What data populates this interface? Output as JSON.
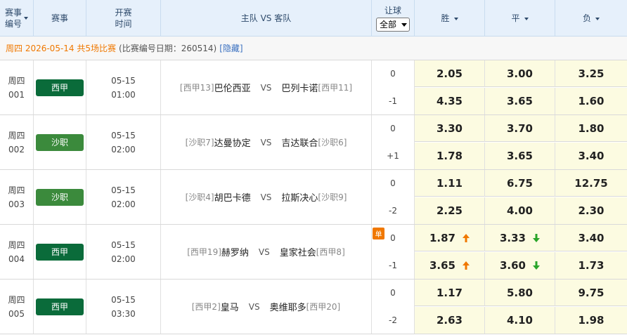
{
  "header": {
    "col_no_line1": "赛事",
    "col_no_line2": "编号",
    "col_league": "赛事",
    "col_time_line1": "开赛",
    "col_time_line2": "时间",
    "col_match": "主队 VS 客队",
    "col_handicap": "让球",
    "handicap_select_value": "全部",
    "col_win": "胜",
    "col_draw": "平",
    "col_lose": "负"
  },
  "dateline": {
    "summary": "周四 2026-05-14 共5场比赛",
    "detail": "(比赛编号日期：260514)",
    "hide_link": "[隐藏]"
  },
  "colors": {
    "la_liga": "#0a6b3a",
    "saudi": "#3b8a3c",
    "odds_bg": "#fcfbe1",
    "up": "#f07800",
    "down": "#2aa52a"
  },
  "matches": [
    {
      "no_day": "周四",
      "no_num": "001",
      "league": "西甲",
      "league_color": "#0a6b3a",
      "date": "05-15",
      "time": "01:00",
      "home_rank": "[西甲13]",
      "home": "巴伦西亚",
      "vs": "VS",
      "away": "巴列卡诺",
      "away_rank": "[西甲11]",
      "hc_top": "0",
      "hc_bot": "-1",
      "odds_top": [
        "2.05",
        "3.00",
        "3.25"
      ],
      "odds_bot": [
        "4.35",
        "3.65",
        "1.60"
      ]
    },
    {
      "no_day": "周四",
      "no_num": "002",
      "league": "沙职",
      "league_color": "#3b8a3c",
      "date": "05-15",
      "time": "02:00",
      "home_rank": "[沙职7]",
      "home": "达曼协定",
      "vs": "VS",
      "away": "吉达联合",
      "away_rank": "[沙职6]",
      "hc_top": "0",
      "hc_bot": "+1",
      "odds_top": [
        "3.30",
        "3.70",
        "1.80"
      ],
      "odds_bot": [
        "1.78",
        "3.65",
        "3.40"
      ]
    },
    {
      "no_day": "周四",
      "no_num": "003",
      "league": "沙职",
      "league_color": "#3b8a3c",
      "date": "05-15",
      "time": "02:00",
      "home_rank": "[沙职4]",
      "home": "胡巴卡德",
      "vs": "VS",
      "away": "拉斯决心",
      "away_rank": "[沙职9]",
      "hc_top": "0",
      "hc_bot": "-2",
      "odds_top": [
        "1.11",
        "6.75",
        "12.75"
      ],
      "odds_bot": [
        "2.25",
        "4.00",
        "2.30"
      ]
    },
    {
      "no_day": "周四",
      "no_num": "004",
      "league": "西甲",
      "league_color": "#0a6b3a",
      "date": "05-15",
      "time": "02:00",
      "home_rank": "[西甲19]",
      "home": "赫罗纳",
      "vs": "VS",
      "away": "皇家社会",
      "away_rank": "[西甲8]",
      "hc_top": "0",
      "hc_bot": "-1",
      "single_badge": "单",
      "odds_top": [
        "1.87",
        "3.33",
        "3.40"
      ],
      "odds_bot": [
        "3.65",
        "3.60",
        "1.73"
      ]
    },
    {
      "no_day": "周四",
      "no_num": "005",
      "league": "西甲",
      "league_color": "#0a6b3a",
      "date": "05-15",
      "time": "03:30",
      "home_rank": "[西甲2]",
      "home": "皇马",
      "vs": "VS",
      "away": "奥维耶多",
      "away_rank": "[西甲20]",
      "hc_top": "0",
      "hc_bot": "-2",
      "odds_top": [
        "1.17",
        "5.80",
        "9.75"
      ],
      "odds_bot": [
        "2.63",
        "4.10",
        "1.98"
      ]
    }
  ]
}
